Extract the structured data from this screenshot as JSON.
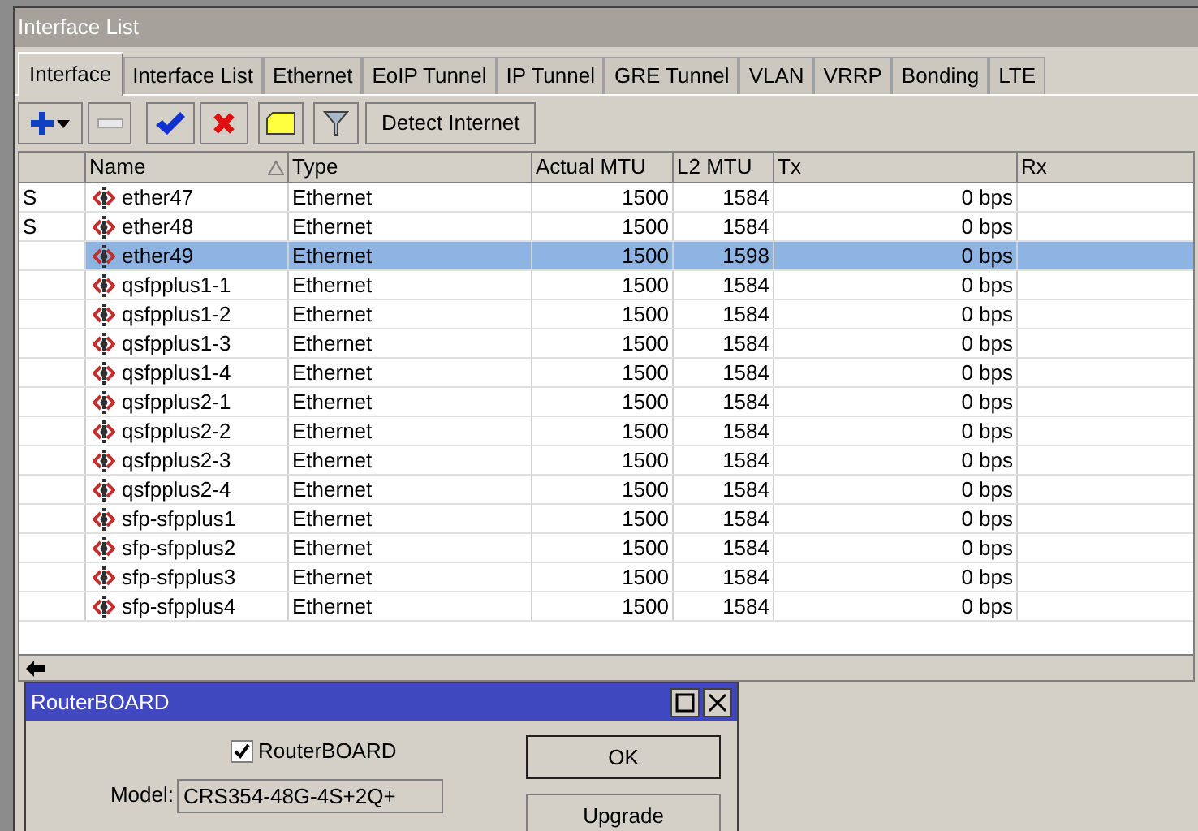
{
  "window": {
    "title": "Interface List"
  },
  "tabs": [
    {
      "label": "Interface",
      "selected": true
    },
    {
      "label": "Interface List",
      "selected": false
    },
    {
      "label": "Ethernet",
      "selected": false
    },
    {
      "label": "EoIP Tunnel",
      "selected": false
    },
    {
      "label": "IP Tunnel",
      "selected": false
    },
    {
      "label": "GRE Tunnel",
      "selected": false
    },
    {
      "label": "VLAN",
      "selected": false
    },
    {
      "label": "VRRP",
      "selected": false
    },
    {
      "label": "Bonding",
      "selected": false
    },
    {
      "label": "LTE",
      "selected": false
    }
  ],
  "toolbar": {
    "detect_button": "Detect Internet"
  },
  "table": {
    "columns": [
      "",
      "Name",
      "Type",
      "Actual MTU",
      "L2 MTU",
      "Tx",
      "Rx"
    ],
    "rows": [
      {
        "flags": "S",
        "name": "ether47",
        "type": "Ethernet",
        "actual_mtu": "1500",
        "l2_mtu": "1584",
        "tx": "0 bps",
        "selected": false
      },
      {
        "flags": "S",
        "name": "ether48",
        "type": "Ethernet",
        "actual_mtu": "1500",
        "l2_mtu": "1584",
        "tx": "0 bps",
        "selected": false
      },
      {
        "flags": "",
        "name": "ether49",
        "type": "Ethernet",
        "actual_mtu": "1500",
        "l2_mtu": "1598",
        "tx": "0 bps",
        "selected": true
      },
      {
        "flags": "",
        "name": "qsfpplus1-1",
        "type": "Ethernet",
        "actual_mtu": "1500",
        "l2_mtu": "1584",
        "tx": "0 bps",
        "selected": false
      },
      {
        "flags": "",
        "name": "qsfpplus1-2",
        "type": "Ethernet",
        "actual_mtu": "1500",
        "l2_mtu": "1584",
        "tx": "0 bps",
        "selected": false
      },
      {
        "flags": "",
        "name": "qsfpplus1-3",
        "type": "Ethernet",
        "actual_mtu": "1500",
        "l2_mtu": "1584",
        "tx": "0 bps",
        "selected": false
      },
      {
        "flags": "",
        "name": "qsfpplus1-4",
        "type": "Ethernet",
        "actual_mtu": "1500",
        "l2_mtu": "1584",
        "tx": "0 bps",
        "selected": false
      },
      {
        "flags": "",
        "name": "qsfpplus2-1",
        "type": "Ethernet",
        "actual_mtu": "1500",
        "l2_mtu": "1584",
        "tx": "0 bps",
        "selected": false
      },
      {
        "flags": "",
        "name": "qsfpplus2-2",
        "type": "Ethernet",
        "actual_mtu": "1500",
        "l2_mtu": "1584",
        "tx": "0 bps",
        "selected": false
      },
      {
        "flags": "",
        "name": "qsfpplus2-3",
        "type": "Ethernet",
        "actual_mtu": "1500",
        "l2_mtu": "1584",
        "tx": "0 bps",
        "selected": false
      },
      {
        "flags": "",
        "name": "qsfpplus2-4",
        "type": "Ethernet",
        "actual_mtu": "1500",
        "l2_mtu": "1584",
        "tx": "0 bps",
        "selected": false
      },
      {
        "flags": "",
        "name": "sfp-sfpplus1",
        "type": "Ethernet",
        "actual_mtu": "1500",
        "l2_mtu": "1584",
        "tx": "0 bps",
        "selected": false
      },
      {
        "flags": "",
        "name": "sfp-sfpplus2",
        "type": "Ethernet",
        "actual_mtu": "1500",
        "l2_mtu": "1584",
        "tx": "0 bps",
        "selected": false
      },
      {
        "flags": "",
        "name": "sfp-sfpplus3",
        "type": "Ethernet",
        "actual_mtu": "1500",
        "l2_mtu": "1584",
        "tx": "0 bps",
        "selected": false
      },
      {
        "flags": "",
        "name": "sfp-sfpplus4",
        "type": "Ethernet",
        "actual_mtu": "1500",
        "l2_mtu": "1584",
        "tx": "0 bps",
        "selected": false
      }
    ]
  },
  "dialog": {
    "title": "RouterBOARD",
    "checkbox": {
      "label": "RouterBOARD",
      "checked": true
    },
    "model_label": "Model:",
    "model_value": "CRS354-48G-4S+2Q+",
    "buttons": [
      "OK",
      "Upgrade"
    ]
  }
}
